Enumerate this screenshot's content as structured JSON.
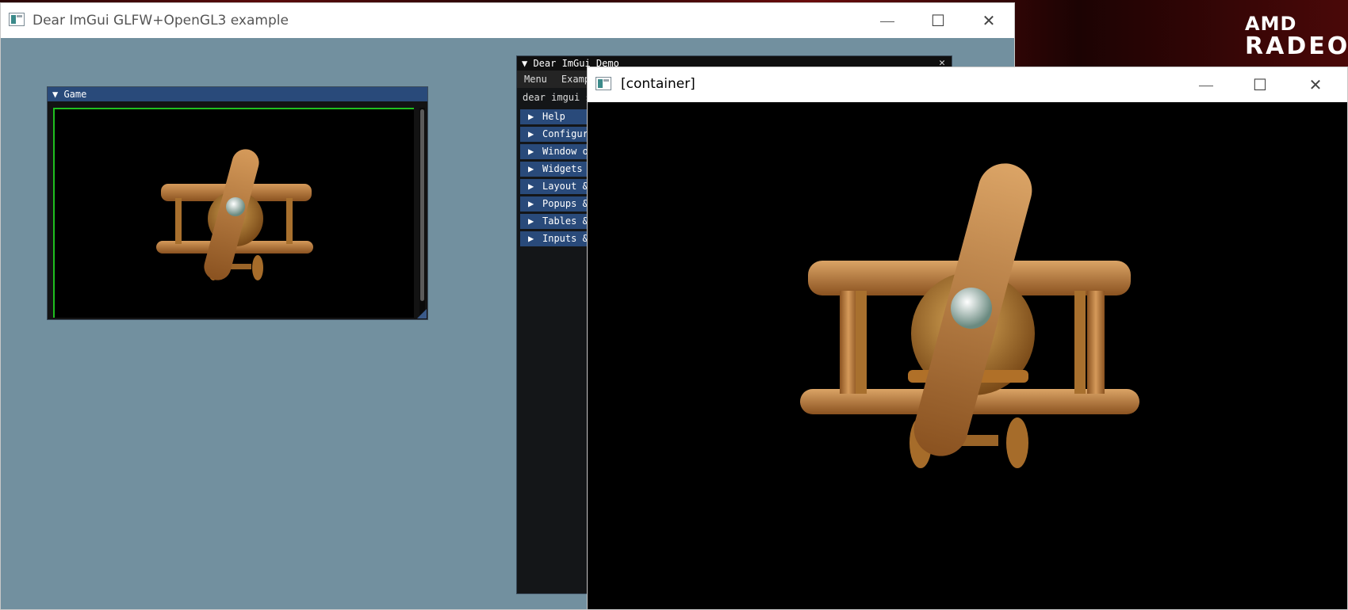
{
  "desktop": {
    "wallpaper_logo": {
      "line1": "AMD",
      "line2": "RADEO"
    }
  },
  "main_window": {
    "title": "Dear ImGui GLFW+OpenGL3 example",
    "background_color": "#72909f",
    "controls": {
      "minimize": "—",
      "maximize": "☐",
      "close": "✕"
    }
  },
  "game_window": {
    "title": "▼ Game",
    "viewport_border_color": "#1fbf1f"
  },
  "demo_window": {
    "title": "▼ Dear ImGui Demo",
    "close": "✕",
    "menu": [
      "Menu",
      "Examples"
    ],
    "intro_text": "dear imgui says hello.",
    "sections": [
      {
        "arrow": "▶",
        "label": "Help"
      },
      {
        "arrow": "▶",
        "label": "Configuration"
      },
      {
        "arrow": "▶",
        "label": "Window options"
      },
      {
        "arrow": "▶",
        "label": "Widgets"
      },
      {
        "arrow": "▶",
        "label": "Layout & Scrolling"
      },
      {
        "arrow": "▶",
        "label": "Popups & Modal windows"
      },
      {
        "arrow": "▶",
        "label": "Tables & Columns"
      },
      {
        "arrow": "▶",
        "label": "Inputs & Focus"
      }
    ]
  },
  "container_window": {
    "title": "[container]",
    "controls": {
      "minimize": "—",
      "maximize": "☐",
      "close": "✕"
    }
  },
  "colors": {
    "imgui_header": "#294a7a",
    "airplane_wood": "#b87a3c"
  }
}
